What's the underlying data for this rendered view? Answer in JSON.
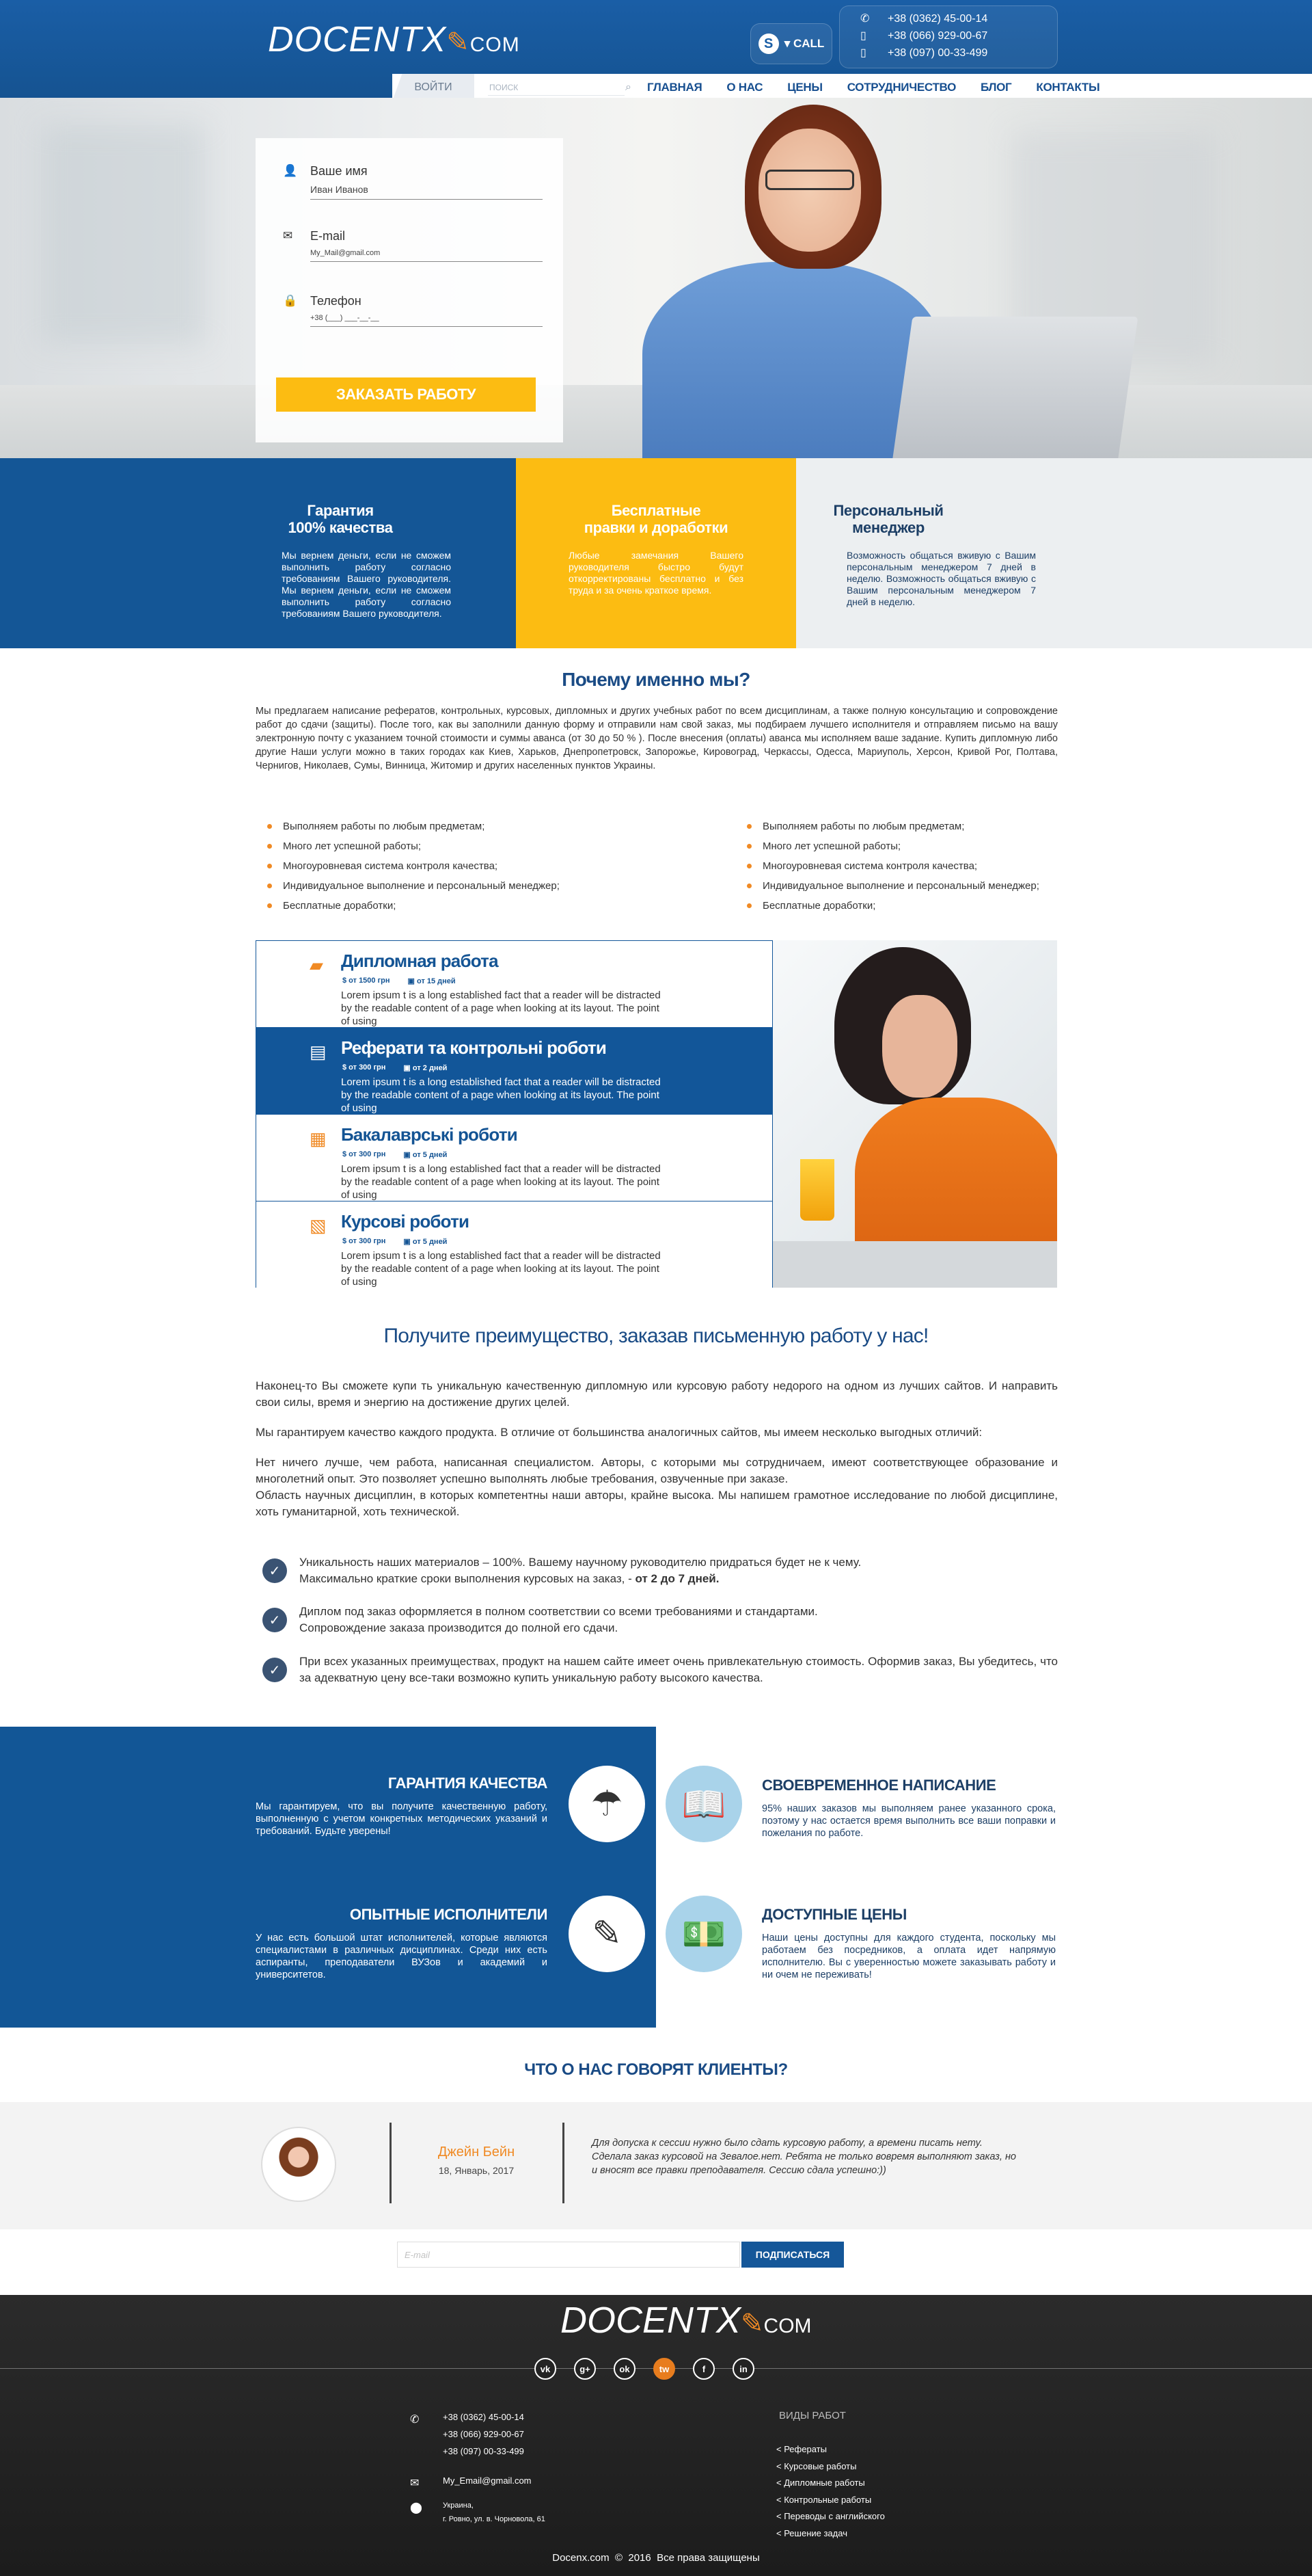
{
  "header": {
    "logo": "DOCENTX",
    "logo_suffix": "COM",
    "skype_label": "▾ CALL",
    "phones": [
      "+38 (0362) 45-00-14",
      "+38 (066) 929-00-67",
      "+38 (097) 00-33-499"
    ]
  },
  "nav": {
    "login": "ВОЙТИ",
    "search_placeholder": "ПОИСК",
    "items": [
      "ГЛАВНАЯ",
      "О НАС",
      "ЦЕНЫ",
      "СОТРУДНИЧЕСТВО",
      "БЛОГ",
      "КОНТАКТЫ"
    ]
  },
  "form": {
    "name_label": "Ваше имя",
    "name_value": "Иван Иванов",
    "email_label": "E-mail",
    "email_value": "My_Mail@gmail.com",
    "phone_label": "Телефон",
    "phone_value": "+38 (___) ___-__-__",
    "submit": "ЗАКАЗАТЬ РАБОТУ"
  },
  "features": [
    {
      "title": "Гарантия\n100% качества",
      "text": "Мы вернем деньги, если не сможем выполнить работу согласно требованиям Вашего руководителя. Мы вернем деньги, если не сможем выполнить работу согласно требованиям Вашего руководителя."
    },
    {
      "title": "Бесплатные\nправки и доработки",
      "text": "Любые замечания Вашего руководителя быстро будут откорректированы бесплатно и без труда и за очень краткое время."
    },
    {
      "title": "Персональный\nменеджер",
      "text": "Возможность общаться вживую с Вашим персональным менеджером 7 дней в неделю. Возможность общаться вживую с Вашим персональным менеджером 7 дней в неделю."
    }
  ],
  "why": {
    "title": "Почему именно мы?",
    "text": "Мы предлагаем написание рефератов, контрольных, курсовых, дипломных и других учебных работ по всем дисциплинам, а также полную консультацию и сопровождение работ до сдачи (защиты). После того, как вы заполнили данную форму и отправили нам свой заказ, мы подбираем лучшего исполнителя и отправляем письмо на вашу электронную почту с указанием точной стоимости и суммы аванса (от 30 до 50 % ). После внесения (оплаты) аванса мы исполняем ваше задание. Купить дипломную либо другие Наши услуги можно в таких городах как Киев, Харьков, Днепропетровск, Запорожье, Кировоград, Черкассы, Одесса, Мариуполь, Херсон, Кривой Рог, Полтава, Чернигов, Николаев, Сумы, Винница, Житомир и других населенных пунктов Украины.",
    "bullets_left": [
      "Выполняем работы по любым предметам;",
      "Много лет успешной работы;",
      "Многоуровневая система контроля качества;",
      "Индивидуальное выполнение и персональный менеджер;",
      "Бесплатные доработки;"
    ],
    "bullets_right": [
      "Выполняем работы по любым предметам;",
      "Много лет успешной работы;",
      "Многоуровневая система контроля качества;",
      "Индивидуальное выполнение и персональный менеджер;",
      "Бесплатные доработки;"
    ]
  },
  "services": [
    {
      "title": "Дипломная работа",
      "price": "$ от 1500 грн",
      "time": "от 15 дней",
      "desc": "Lorem ipsum t is a long established fact that a reader will be distracted by the readable content of a page when looking at its layout. The point of using",
      "icon": "folder-icon"
    },
    {
      "title": "Реферати та контрольні роботи",
      "price": "$ от 300 грн",
      "time": "от 2 дней",
      "desc": "Lorem ipsum t is a long established fact that a reader will be distracted by the readable content of a page when looking at its layout. The point of using",
      "icon": "document-icon"
    },
    {
      "title": "Бакалаврські роботи",
      "price": "$ от 300 грн",
      "time": "от 5 дней",
      "desc": "Lorem ipsum t is a long established fact that a reader will be distracted by the readable content of a page when looking at its layout. The point of using",
      "icon": "certificate-icon"
    },
    {
      "title": "Курсові роботи",
      "price": "$ от 300 грн",
      "time": "от 5 дней",
      "desc": "Lorem ipsum t is a long established fact that a reader will be distracted by the readable content of a page when looking at its layout. The point of using",
      "icon": "search-document-icon"
    }
  ],
  "advantage": {
    "title": "Получите преимущество, заказав письменную работу у нас!",
    "p1": "Наконец-то Вы сможете купи ть уникальную качественную дипломную или курсовую работу недорого на одном из лучших сайтов. И направить свои силы, время и энергию на достижение других целей.",
    "p2": "Мы гарантируем качество каждого продукта. В отличие от большинства аналогичных сайтов, мы имеем несколько выгодных отличий:",
    "p3": "Нет ничего лучше, чем работа, написанная специалистом. Авторы, с которыми мы сотрудничаем, имеют соответствующее образование и многолетний опыт. Это позволяет успешно выполнять любые требования, озвученные при заказе.",
    "p4": "Область научных дисциплин, в которых компетентны наши авторы, крайне высока. Мы напишем грамотное исследование по любой дисциплине, хоть гуманитарной, хоть технической.",
    "check1_a": "Уникальность наших материалов – 100%. Вашему научному руководителю придраться будет не к чему.",
    "check1_b": "Максимально краткие сроки выполнения курсовых на заказ, -",
    "check1_bold": "от 2 до 7 дней.",
    "check2_a": "Диплом под заказ оформляется в полном соответствии со всеми требованиями и стандартами.",
    "check2_b": "Сопровождение заказа производится до полной его сдачи.",
    "check3": "При всех указанных преимуществах, продукт на нашем сайте имеет очень привлекательную стоимость. Оформив заказ, Вы убедитесь, что за адекватную цену все-таки возможно купить уникальную работу высокого качества."
  },
  "grid": {
    "quality_title": "ГАРАНТИЯ КАЧЕСТВА",
    "quality_text": "Мы гарантируем, что вы получите качественную работу, выполненную с учетом конкретных методических указаний и требований. Будьте уверены!",
    "experts_title": "ОПЫТНЫЕ ИСПОЛНИТЕЛИ",
    "experts_text": "У нас есть большой штат исполнителей, которые являются специалистами в различных дисциплинах. Среди них есть аспиранты, преподаватели ВУЗов и академий и университетов.",
    "ontime_title": "СВОЕВРЕМЕННОЕ НАПИСАНИЕ",
    "ontime_text": "95% наших заказов мы выполняем ранее указанного срока, поэтому у нас остается время выполнить все ваши поправки и пожелания по работе.",
    "prices_title": "ДОСТУПНЫЕ ЦЕНЫ",
    "prices_text": "Наши цены доступны для каждого студента, поскольку мы работаем без посредников, а оплата идет напрямую исполнителю. Вы с уверенностью можете заказывать работу и ни очем не переживать!"
  },
  "testimonials": {
    "title": "ЧТО О НАС ГОВОРЯТ КЛИЕНТЫ?",
    "name": "Джейн Бейн",
    "date": "18, Январь, 2017",
    "quote": "Для допуска к сессии нужно было сдать курсовую работу, а времени писать нету. Сделала заказ курсовой на Зевалое.нет. Ребята не только вовремя выполняют заказ, но и вносят все правки преподавателя. Сессию сдала успешно:))"
  },
  "subscribe": {
    "placeholder": "E-mail",
    "button": "ПОДПИСАТЬСЯ"
  },
  "footer": {
    "logo": "DOCENTX",
    "logo_suffix": "COM",
    "socials": [
      "vk",
      "g+",
      "ok",
      "tw",
      "f",
      "in"
    ],
    "phones": [
      "+38 (0362) 45-00-14",
      "+38 (066) 929-00-67",
      "+38 (097) 00-33-499"
    ],
    "email": "My_Email@gmail.com",
    "address_1": "Украина,",
    "address_2": "г. Ровно, ул. в. Чорновола, 61",
    "col_title": "ВИДЫ РАБОТ",
    "links": [
      "< Рефераты",
      "< Курсовые работы",
      "< Дипломные работы",
      "< Контрольные работы",
      "< Переводы с английского",
      "< Решение задач"
    ],
    "copyright_site": "Docenx.com",
    "copyright_year": "2016",
    "copyright_text": "Все права защищены"
  },
  "colors": {
    "brand_blue": "#145696",
    "accent_yellow": "#fcbc12",
    "accent_orange": "#f08a24"
  }
}
